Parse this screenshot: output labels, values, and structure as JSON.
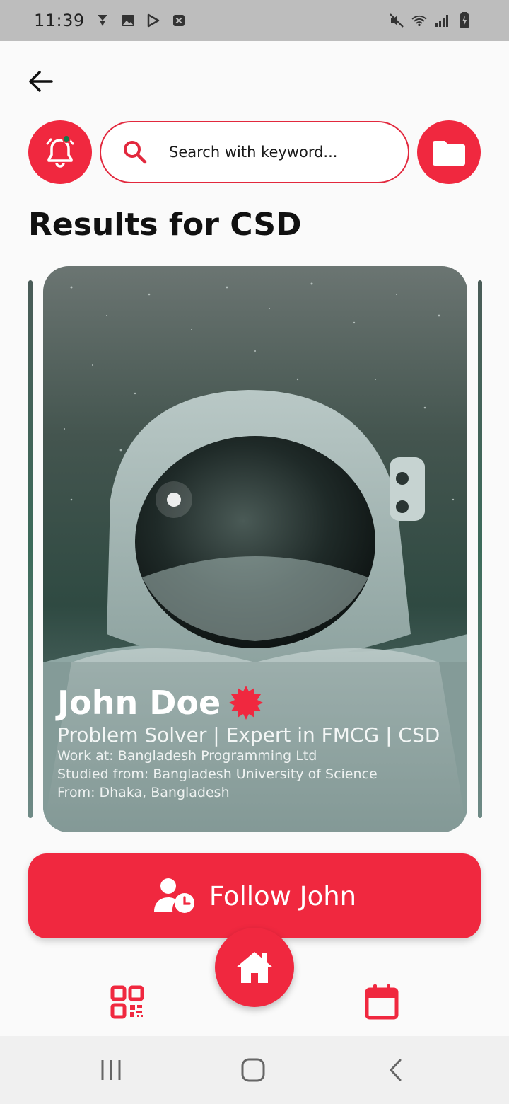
{
  "status_bar": {
    "time": "11:39",
    "left_icons": [
      "notification-icon",
      "gallery-icon",
      "play-store-icon",
      "close-box-icon"
    ],
    "right_icons": [
      "mute-icon",
      "wifi-icon",
      "signal-icon",
      "battery-charging-icon"
    ]
  },
  "header": {
    "back_icon": "arrow-left-icon"
  },
  "search": {
    "placeholder": "Search with keyword..."
  },
  "results": {
    "title": "Results for CSD"
  },
  "profile": {
    "name": "John Doe",
    "headline": "Problem Solver | Expert in FMCG | CSD",
    "work": "Work at: Bangladesh Programming Ltd",
    "study": "Studied from: Bangladesh University of Science",
    "from": "From: Dhaka, Bangladesh",
    "photo": "astronaut-on-moon"
  },
  "follow": {
    "label": "Follow John"
  },
  "bottom_nav": {
    "items": [
      "qr-code-icon",
      "home-icon",
      "calendar-icon"
    ]
  },
  "colors": {
    "accent": "#f0283f",
    "notification_dot": "#0f7a4a"
  }
}
